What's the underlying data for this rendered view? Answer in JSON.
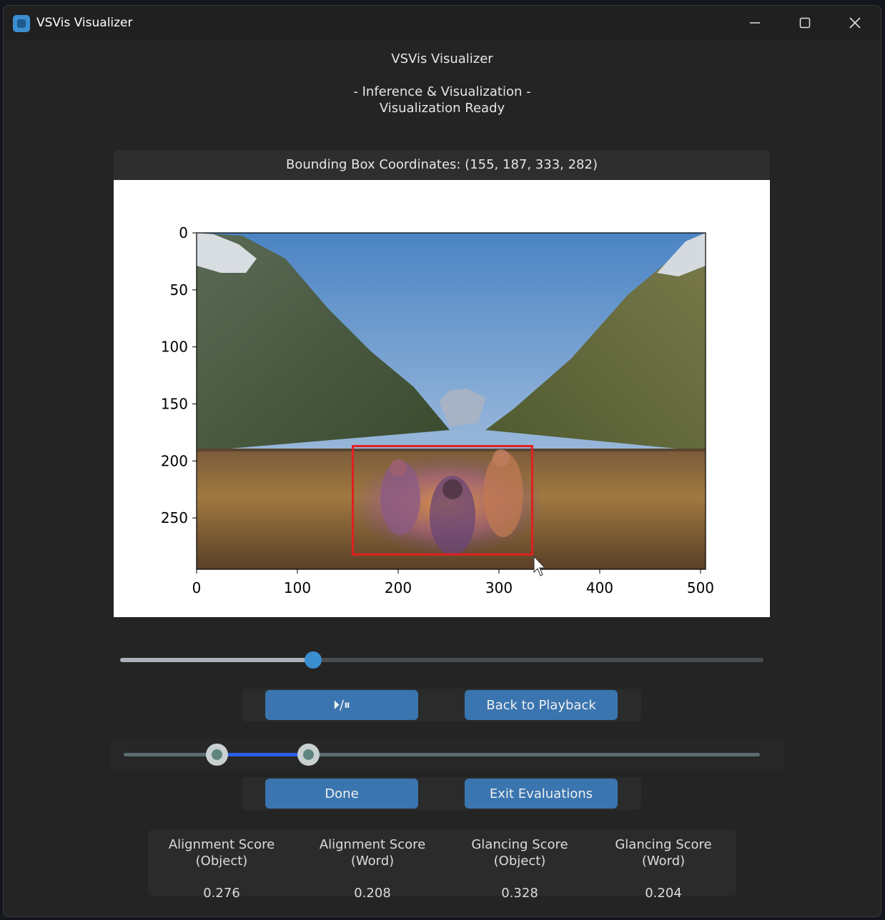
{
  "window": {
    "title": "VSVis Visualizer"
  },
  "header": {
    "title": "VSVis Visualizer",
    "subtitle": "- Inference & Visualization -",
    "status": "Visualization Ready"
  },
  "bbox": {
    "label": "Bounding Box Coordinates: (155, 187, 333, 282)",
    "x1": 155,
    "y1": 187,
    "x2": 333,
    "y2": 282
  },
  "plot": {
    "image_width": 505,
    "image_height": 295,
    "x_ticks": [
      "0",
      "100",
      "200",
      "300",
      "400",
      "500"
    ],
    "y_ticks": [
      "0",
      "50",
      "100",
      "150",
      "200",
      "250"
    ]
  },
  "playback": {
    "position_fraction": 0.3,
    "play_pause_label": "⏵/⏸",
    "back_label": "Back to Playback"
  },
  "range": {
    "start_fraction": 0.146,
    "end_fraction": 0.29
  },
  "evaluation": {
    "done_label": "Done",
    "exit_label": "Exit Evaluations"
  },
  "scores": [
    {
      "line1": "Alignment Score",
      "line2": "(Object)",
      "value": "0.276"
    },
    {
      "line1": "Alignment Score",
      "line2": "(Word)",
      "value": "0.208"
    },
    {
      "line1": "Glancing Score",
      "line2": "(Object)",
      "value": "0.328"
    },
    {
      "line1": "Glancing Score",
      "line2": "(Word)",
      "value": "0.204"
    }
  ],
  "colors": {
    "accent": "#3a75b0",
    "bbox": "#e02020",
    "range_selected": "#2e5fe8"
  }
}
